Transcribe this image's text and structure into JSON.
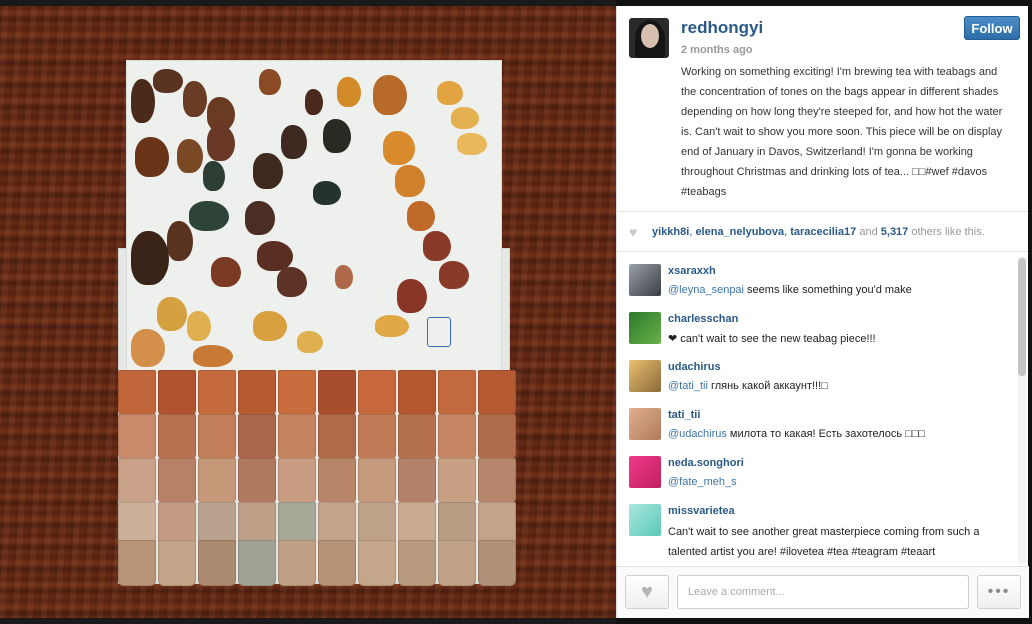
{
  "post": {
    "username": "redhongyi",
    "time_ago": "2 months ago",
    "follow_label": "Follow",
    "caption": "Working on something exciting! I'm brewing tea with teabags and the concentration of tones on the bags appear in different shades depending on how long they're steeped for, and how hot the water is. Can't wait to show you more soon. This piece will be on display end of January in Davos, Switzerland! I'm gonna be working throughout Christmas and drinking lots of tea... □□#wef #davos #teabags"
  },
  "likes": {
    "user1": "yikkh8i",
    "user2": "elena_nelyubova",
    "user3": "taracecilia17",
    "and": "and",
    "count": "5,317",
    "suffix": "others like this."
  },
  "comments": [
    {
      "user": "xsaraxxh",
      "mention": "@leyna_senpai",
      "text": " seems like something you'd make"
    },
    {
      "user": "charlesschan",
      "mention": "",
      "text": "❤ can't wait to see the new teabag piece!!!"
    },
    {
      "user": "udachirus",
      "mention": "@tati_tii",
      "text": " глянь какой аккаунт!!!□"
    },
    {
      "user": "tati_tii",
      "mention": "@udachirus",
      "text": " милота то какая! Есть захотелось □□□"
    },
    {
      "user": "neda.songhori",
      "mention": "@fate_meh_s",
      "text": ""
    },
    {
      "user": "missvarietea",
      "mention": "",
      "text": "Can't wait to see another great masterpiece coming from such a talented artist you are! #ilovetea #tea #teagram #teaart"
    }
  ],
  "footer": {
    "comment_placeholder": "Leave a comment...",
    "more_label": "•••"
  },
  "colors": {
    "link": "#2a5a87",
    "follow_button": "#2e6ea8",
    "wood": "#5a2412"
  }
}
